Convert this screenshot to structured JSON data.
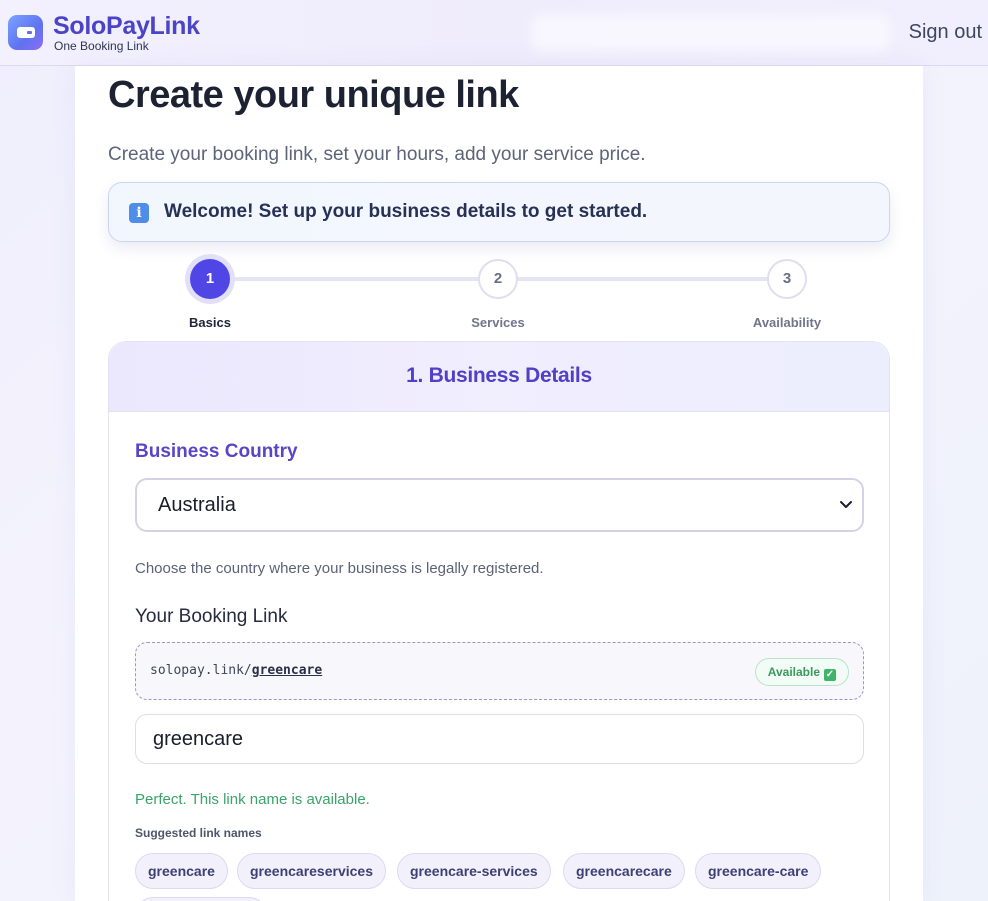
{
  "header": {
    "brand_name": "SoloPayLink",
    "brand_tagline": "One Booking Link",
    "sign_out_label": "Sign out"
  },
  "page": {
    "title": "Create your unique link",
    "subtitle": "Create your booking link, set your hours, add your service price.",
    "welcome_message": "Welcome! Set up your business details to get started."
  },
  "stepper": {
    "current_step": 1,
    "steps": [
      {
        "number": "1",
        "label": "Basics"
      },
      {
        "number": "2",
        "label": "Services"
      },
      {
        "number": "3",
        "label": "Availability"
      }
    ]
  },
  "form": {
    "section_title": "1. Business Details",
    "country_label": "Business Country",
    "country_value": "Australia",
    "country_helper": "Choose the country where your business is legally registered.",
    "booking_link_label": "Your Booking Link",
    "link_prefix": "solopay.link/",
    "link_slug": "greencare",
    "availability_badge": "Available",
    "link_name_value": "greencare",
    "availability_message": "Perfect. This link name is available.",
    "suggestions_label": "Suggested link names",
    "suggestions": [
      "greencare",
      "greencareservices",
      "greencare-services",
      "greencarecare",
      "greencare-care"
    ]
  },
  "colors": {
    "accent": "#4f46e5",
    "brand": "#4b44c6",
    "success": "#3aa36a",
    "section_title": "#5140c7"
  },
  "icons": {
    "logo": "wallet-card-icon",
    "info": "info-icon",
    "select_chevron": "chevron-down-icon",
    "available": "check-icon"
  }
}
